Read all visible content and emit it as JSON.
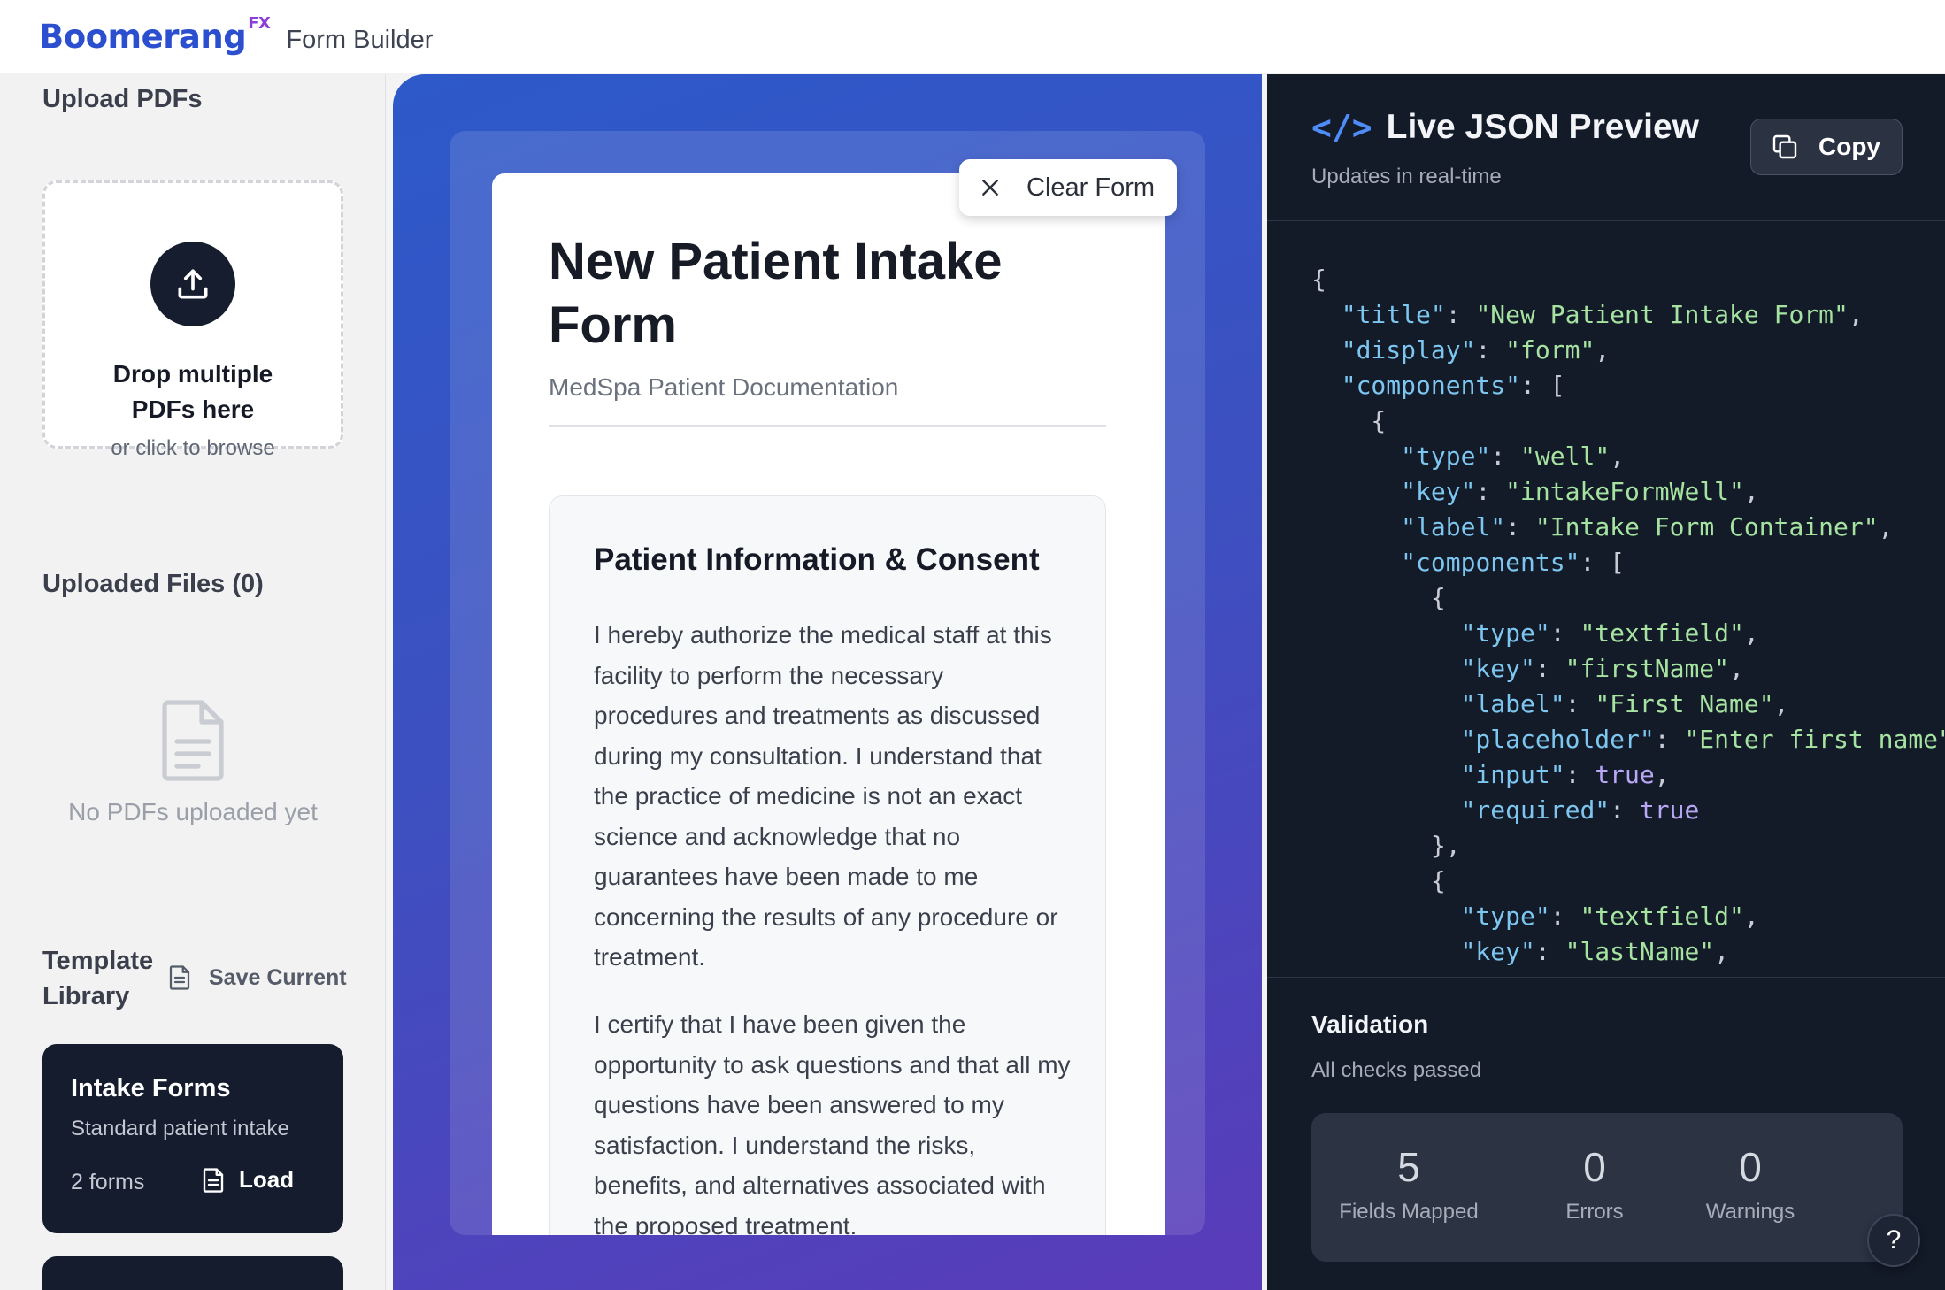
{
  "header": {
    "brand": "Boomerang",
    "brand_sup": "FX",
    "subtitle": "Form Builder"
  },
  "sidebar": {
    "upload_title": "Upload PDFs",
    "drop_main_1": "Drop multiple",
    "drop_main_2": "PDFs here",
    "drop_sub": "or click to browse",
    "uploaded_title": "Uploaded Files (0)",
    "empty_text": "No PDFs uploaded yet",
    "template_title_1": "Template",
    "template_title_2": "Library",
    "save_current": "Save Current",
    "templates": [
      {
        "title": "Intake Forms",
        "subtitle": "Standard patient intake",
        "count": "2 forms",
        "load": "Load"
      }
    ]
  },
  "center": {
    "clear_form": "Clear Form",
    "form_title": "New Patient Intake Form",
    "form_subtitle": "MedSpa Patient Documentation",
    "section_title": "Patient Information & Consent",
    "paragraph_1": "I hereby authorize the medical staff at this facility to perform the necessary procedures and treatments as discussed during my consultation. I understand that the practice of medicine is not an exact science and acknowledge that no guarantees have been made to me concerning the results of any procedure or treatment.",
    "paragraph_2": "I certify that I have been given the opportunity to ask questions and that all my questions have been answered to my satisfaction. I understand the risks, benefits, and alternatives associated with the proposed treatment."
  },
  "right": {
    "code_glyph": "</>",
    "title": "Live JSON Preview",
    "subtitle": "Updates in real-time",
    "copy": "Copy",
    "json_lines": [
      [
        [
          "p",
          "{"
        ]
      ],
      [
        [
          "p",
          "  "
        ],
        [
          "k",
          "\"title\""
        ],
        [
          "p",
          ": "
        ],
        [
          "s",
          "\"New Patient Intake Form\""
        ],
        [
          "p",
          ","
        ]
      ],
      [
        [
          "p",
          "  "
        ],
        [
          "k",
          "\"display\""
        ],
        [
          "p",
          ": "
        ],
        [
          "s",
          "\"form\""
        ],
        [
          "p",
          ","
        ]
      ],
      [
        [
          "p",
          "  "
        ],
        [
          "k",
          "\"components\""
        ],
        [
          "p",
          ": ["
        ]
      ],
      [
        [
          "p",
          "    {"
        ]
      ],
      [
        [
          "p",
          "      "
        ],
        [
          "k",
          "\"type\""
        ],
        [
          "p",
          ": "
        ],
        [
          "s",
          "\"well\""
        ],
        [
          "p",
          ","
        ]
      ],
      [
        [
          "p",
          "      "
        ],
        [
          "k",
          "\"key\""
        ],
        [
          "p",
          ": "
        ],
        [
          "s",
          "\"intakeFormWell\""
        ],
        [
          "p",
          ","
        ]
      ],
      [
        [
          "p",
          "      "
        ],
        [
          "k",
          "\"label\""
        ],
        [
          "p",
          ": "
        ],
        [
          "s",
          "\"Intake Form Container\""
        ],
        [
          "p",
          ","
        ]
      ],
      [
        [
          "p",
          "      "
        ],
        [
          "k",
          "\"components\""
        ],
        [
          "p",
          ": ["
        ]
      ],
      [
        [
          "p",
          "        {"
        ]
      ],
      [
        [
          "p",
          "          "
        ],
        [
          "k",
          "\"type\""
        ],
        [
          "p",
          ": "
        ],
        [
          "s",
          "\"textfield\""
        ],
        [
          "p",
          ","
        ]
      ],
      [
        [
          "p",
          "          "
        ],
        [
          "k",
          "\"key\""
        ],
        [
          "p",
          ": "
        ],
        [
          "s",
          "\"firstName\""
        ],
        [
          "p",
          ","
        ]
      ],
      [
        [
          "p",
          "          "
        ],
        [
          "k",
          "\"label\""
        ],
        [
          "p",
          ": "
        ],
        [
          "s",
          "\"First Name\""
        ],
        [
          "p",
          ","
        ]
      ],
      [
        [
          "p",
          "          "
        ],
        [
          "k",
          "\"placeholder\""
        ],
        [
          "p",
          ": "
        ],
        [
          "s",
          "\"Enter first name\""
        ],
        [
          "p",
          ","
        ]
      ],
      [
        [
          "p",
          "          "
        ],
        [
          "k",
          "\"input\""
        ],
        [
          "p",
          ": "
        ],
        [
          "b",
          "true"
        ],
        [
          "p",
          ","
        ]
      ],
      [
        [
          "p",
          "          "
        ],
        [
          "k",
          "\"required\""
        ],
        [
          "p",
          ": "
        ],
        [
          "b",
          "true"
        ]
      ],
      [
        [
          "p",
          "        },"
        ]
      ],
      [
        [
          "p",
          "        {"
        ]
      ],
      [
        [
          "p",
          "          "
        ],
        [
          "k",
          "\"type\""
        ],
        [
          "p",
          ": "
        ],
        [
          "s",
          "\"textfield\""
        ],
        [
          "p",
          ","
        ]
      ],
      [
        [
          "p",
          "          "
        ],
        [
          "k",
          "\"key\""
        ],
        [
          "p",
          ": "
        ],
        [
          "s",
          "\"lastName\""
        ],
        [
          "p",
          ","
        ]
      ]
    ],
    "validation_title": "Validation",
    "validation_sub": "All checks passed",
    "stats": [
      {
        "value": "5",
        "label": "Fields Mapped"
      },
      {
        "value": "0",
        "label": "Errors"
      },
      {
        "value": "0",
        "label": "Warnings"
      }
    ],
    "help": "?"
  },
  "colors": {
    "brand": "#2b4fcf",
    "brand_sup": "#8b3fd9",
    "json_key": "#7cc6f0",
    "json_string": "#a6e3a1",
    "json_bool": "#b7a7f5"
  }
}
